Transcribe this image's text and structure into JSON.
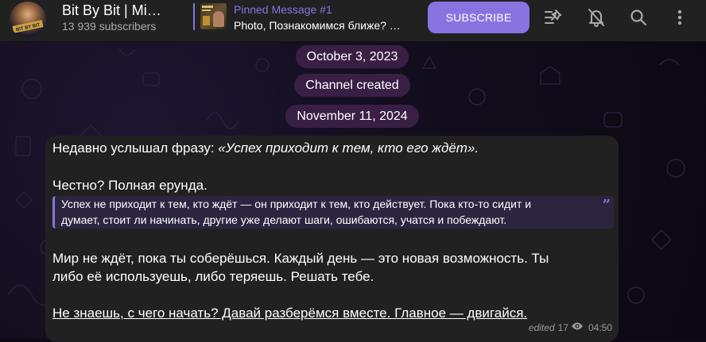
{
  "channel": {
    "title": "Bit By Bit | Mi…",
    "subscribers": "13 939 subscribers",
    "avatar_text": "BIT BY BIT"
  },
  "pinned": {
    "title": "Pinned Message #1",
    "text": "Photo, Познакомимся ближе? …"
  },
  "header": {
    "subscribe_label": "SUBSCRIBE",
    "icons": [
      "pinned-list-icon",
      "mute-bell-icon",
      "search-icon",
      "more-vertical-icon"
    ]
  },
  "service": {
    "date1": "October 3, 2023",
    "created": "Channel created",
    "date2": "November 11, 2024"
  },
  "message": {
    "line1_plain": "Недавно услышал фразу: ",
    "line1_italic": "«Успех приходит к тем, кто его ждёт».",
    "line2": "Честно? Полная ерунда.",
    "quote_line1": "Успех не приходит к тем, кто ждёт — он приходит к тем, кто действует. Пока кто-то сидит и",
    "quote_line2": "думает, стоит ли начинать, другие уже делают шаги, ошибаются, учатся и побеждают.",
    "line3": "Мир не ждёт, пока ты соберёшься. Каждый день — это новая возможность. Ты",
    "line4": "либо её используешь, либо теряешь. Решать тебе.",
    "line5": "Не знаешь, с чего начать? Давай разберёмся вместе. Главное — двигайся.",
    "edited": "edited",
    "views": "17",
    "time": "04:50"
  },
  "colors": {
    "accent": "#8774e1",
    "header_bg": "#212121",
    "pill_bg": "#3a1f45",
    "bubble_bg": "#212121"
  }
}
